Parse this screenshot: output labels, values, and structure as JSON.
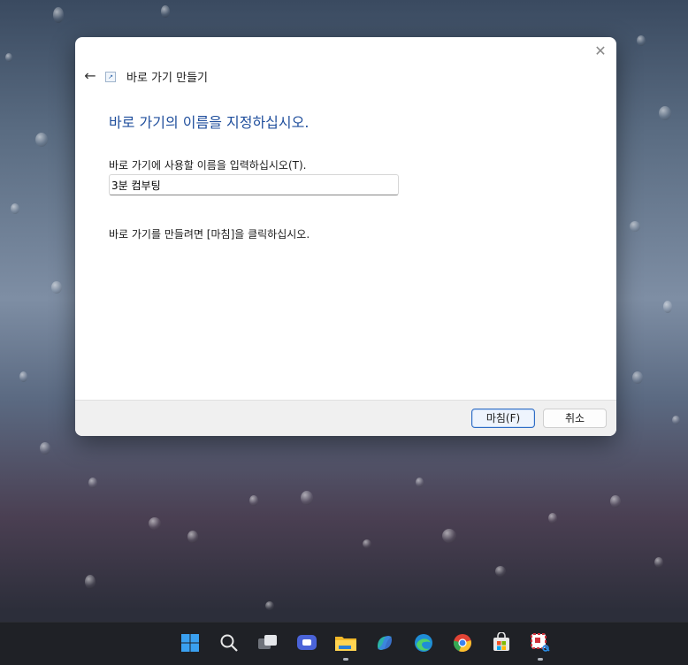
{
  "dialog": {
    "title": "바로 가기 만들기",
    "heading": "바로 가기의 이름을 지정하십시오.",
    "prompt": "바로 가기에 사용할 이름을 입력하십시오(T).",
    "name_value": "3분 컴부팅",
    "finish_note": "바로 가기를 만들려면 [마침]을 클릭하십시오.",
    "finish_label": "마침(F)",
    "cancel_label": "취소",
    "close_glyph": "✕",
    "back_glyph": "←"
  },
  "taskbar": {
    "icons": [
      "windows-start-icon",
      "search-icon",
      "task-view-icon",
      "teams-chat-icon",
      "file-explorer-icon",
      "copilot-icon",
      "edge-icon",
      "chrome-icon",
      "microsoft-store-icon",
      "snipping-tool-icon"
    ],
    "accent": "#0a84d8"
  }
}
